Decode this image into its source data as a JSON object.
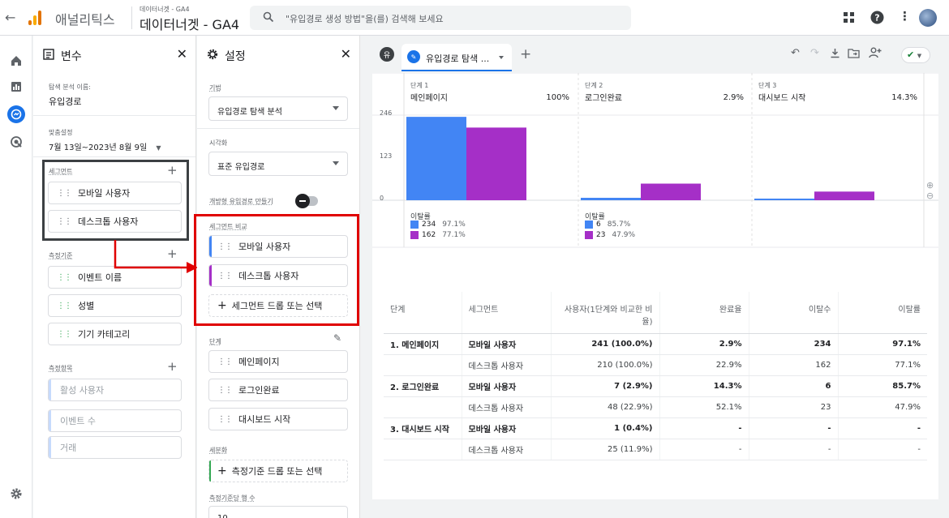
{
  "header": {
    "app_name": "애널리틱스",
    "property_small": "데이터너겟 - GA4",
    "property_name": "데이터너겟 - GA4",
    "search_placeholder": "\"유입경로 생성 방법\"을(를) 검색해 보세요",
    "icons": [
      "back-arrow-icon",
      "apps-grid-icon",
      "help-icon",
      "more-vert-icon",
      "avatar"
    ]
  },
  "rail": {
    "icons": [
      "home-icon",
      "reports-icon",
      "explore-icon",
      "advertising-icon",
      "settings-icon"
    ],
    "active": "explore-icon"
  },
  "variables": {
    "title": "변수",
    "exploration_name_label": "탐색 분석 이름:",
    "exploration_name": "유입경로",
    "date_label": "맞춤설정",
    "date_range": "7월 13일~2023년 8월 9일",
    "segments_label": "세그먼트",
    "segments": [
      "모바일 사용자",
      "데스크톱 사용자"
    ],
    "dimensions_label": "측정기준",
    "dimensions": [
      "이벤트 이름",
      "성별",
      "기기 카테고리"
    ],
    "metrics_label": "측정항목",
    "metrics": [
      "활성 사용자",
      "이벤트 수",
      "거래"
    ]
  },
  "settings": {
    "title": "설정",
    "technique_label": "기법",
    "technique": "유입경로 탐색 분석",
    "viz_label": "시각화",
    "viz": "표준 유입경로",
    "open_funnel_label": "개방형 유입경로 만들기",
    "segment_compare_label": "세그먼트 비교",
    "segment_compare": [
      "모바일 사용자",
      "데스크톱 사용자"
    ],
    "drop_segment": "세그먼트 드롭 또는 선택",
    "steps_label": "단계",
    "steps": [
      "메인페이지",
      "로그인완료",
      "대시보드 시작"
    ],
    "breakdown_label": "세분화",
    "drop_dimension": "측정기준 드롭 또는 선택",
    "rows_label": "측정기준당 행 수",
    "rows_value": "10"
  },
  "canvas": {
    "tab_label": "유입경로 탐색 ...",
    "variables_badge": "유",
    "check_state": "success"
  },
  "chart_data": {
    "type": "bar",
    "y_ticks": [
      "246",
      "123",
      "0"
    ],
    "ylim": [
      0,
      246
    ],
    "categories": [
      "메인페이지",
      "로그인완료",
      "대시보드 시작"
    ],
    "stage_labels": [
      "단계 1",
      "단계 2",
      "단계 3"
    ],
    "stage_pcts": [
      "100%",
      "2.9%",
      "14.3%"
    ],
    "series": [
      {
        "name": "모바일 사용자",
        "color": "#4285f4",
        "values": [
          241,
          7,
          1
        ]
      },
      {
        "name": "데스크톱 사용자",
        "color": "#a52fc7",
        "values": [
          210,
          48,
          25
        ]
      }
    ],
    "dropoff_label": "이탈률",
    "dropoffs": [
      [
        {
          "count": "234",
          "pct": "97.1%"
        },
        {
          "count": "162",
          "pct": "77.1%"
        }
      ],
      [
        {
          "count": "6",
          "pct": "85.7%"
        },
        {
          "count": "23",
          "pct": "47.9%"
        }
      ]
    ]
  },
  "table": {
    "headers": [
      "단계",
      "세그먼트",
      "사용자(1단계와 비교한 비율)",
      "완료율",
      "이탈수",
      "이탈률"
    ],
    "rows": [
      {
        "step": "1. 메인페이지",
        "segment": "모바일 사용자",
        "users": "241 (100.0%)",
        "completion": "2.9%",
        "abandon": "234",
        "abandon_rate": "97.1%"
      },
      {
        "step": "",
        "segment": "데스크톱 사용자",
        "users": "210 (100.0%)",
        "completion": "22.9%",
        "abandon": "162",
        "abandon_rate": "77.1%"
      },
      {
        "step": "2. 로그인완료",
        "segment": "모바일 사용자",
        "users": "7 (2.9%)",
        "completion": "14.3%",
        "abandon": "6",
        "abandon_rate": "85.7%"
      },
      {
        "step": "",
        "segment": "데스크톱 사용자",
        "users": "48 (22.9%)",
        "completion": "52.1%",
        "abandon": "23",
        "abandon_rate": "47.9%"
      },
      {
        "step": "3. 대시보드 시작",
        "segment": "모바일 사용자",
        "users": "1 (0.4%)",
        "completion": "-",
        "abandon": "-",
        "abandon_rate": "-"
      },
      {
        "step": "",
        "segment": "데스크톱 사용자",
        "users": "25 (11.9%)",
        "completion": "-",
        "abandon": "-",
        "abandon_rate": "-"
      }
    ]
  }
}
